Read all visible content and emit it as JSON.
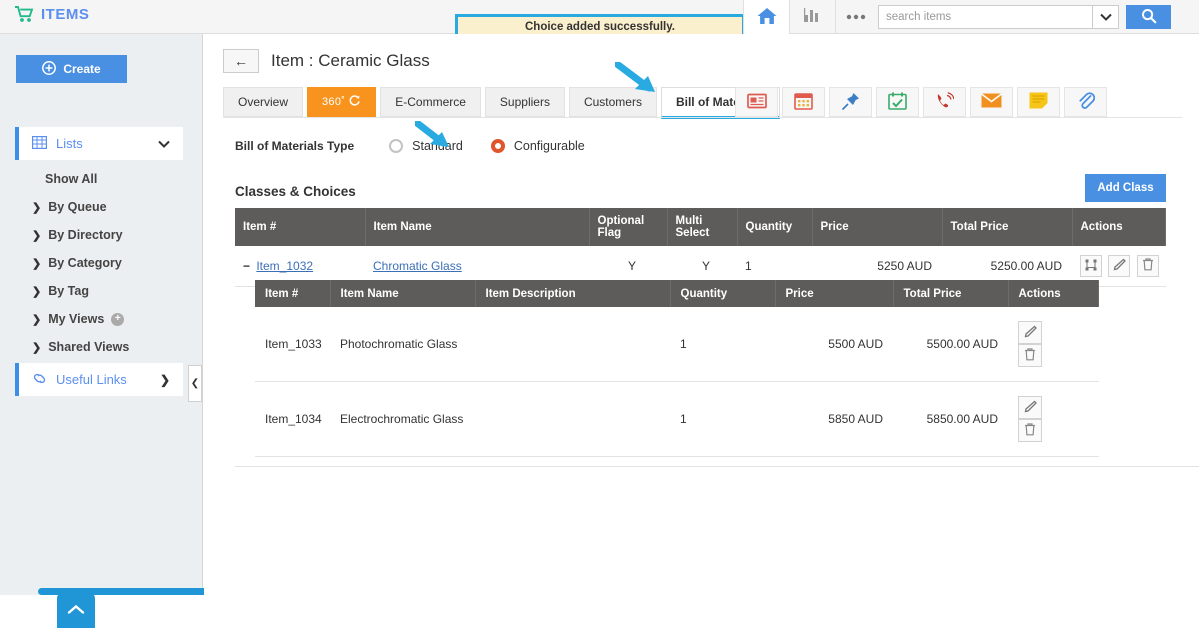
{
  "header": {
    "brand": "ITEMS",
    "brand_icon": "shopping-cart-icon",
    "notification": "Choice added successfully.",
    "home_icon": "home-icon",
    "chart_icon": "bar-chart-icon",
    "more_icon": "ellipsis-icon",
    "search": {
      "value": "",
      "placeholder": "search items"
    },
    "search_caret_icon": "chevron-down-icon",
    "search_button_icon": "search-icon",
    "accent_blue": "#4a90e2",
    "notif_border": "#29abe2",
    "notif_bg": "#fbf0cd"
  },
  "sidebar": {
    "create_label": "Create",
    "create_icon": "plus-circle-icon",
    "lists": {
      "label": "Lists",
      "icon": "grid-icon",
      "chevron": "chevron-down-icon"
    },
    "items": [
      {
        "label": "Show All",
        "has_arrow": false
      },
      {
        "label": "By Queue",
        "has_arrow": true
      },
      {
        "label": "By Directory",
        "has_arrow": true
      },
      {
        "label": "By Category",
        "has_arrow": true
      },
      {
        "label": "By Tag",
        "has_arrow": true
      },
      {
        "label": "My Views",
        "has_arrow": true,
        "has_plus": true
      },
      {
        "label": "Shared Views",
        "has_arrow": true
      }
    ],
    "useful_links": {
      "label": "Useful Links",
      "icon": "link-icon",
      "chevron": "chevron-right-icon"
    },
    "collapse_icon": "chevron-left-icon",
    "scroll_top_icon": "chevron-up-icon"
  },
  "main": {
    "back_icon": "arrow-left-icon",
    "page_title": "Item : Ceramic Glass",
    "tabs": [
      {
        "label": "Overview",
        "state": "normal"
      },
      {
        "label": "360˚",
        "state": "orange"
      },
      {
        "label": "E-Commerce",
        "state": "normal"
      },
      {
        "label": "Suppliers",
        "state": "normal"
      },
      {
        "label": "Customers",
        "state": "normal"
      },
      {
        "label": "Bill of Materials",
        "state": "active"
      }
    ],
    "icon_tabs": [
      {
        "name": "news-card-icon",
        "color": "#e05b4f"
      },
      {
        "name": "calendar-icon",
        "color": "#e05b4f"
      },
      {
        "name": "pin-icon",
        "color": "#3b7fc4"
      },
      {
        "name": "calendar-check-icon",
        "color": "#3bab6b"
      },
      {
        "name": "phone-call-icon",
        "color": "#c0392b"
      },
      {
        "name": "envelope-icon",
        "color": "#f0901e"
      },
      {
        "name": "note-icon",
        "color": "#f5c518"
      },
      {
        "name": "paperclip-icon",
        "color": "#4a90e2"
      }
    ],
    "bom_type": {
      "label": "Bill of Materials Type",
      "options": [
        {
          "label": "Standard",
          "selected": false
        },
        {
          "label": "Configurable",
          "selected": true
        }
      ],
      "selected_color": "#e0552b"
    },
    "section_title": "Classes & Choices",
    "add_class_label": "Add Class",
    "outer_table": {
      "columns": [
        "Item #",
        "Item Name",
        "Optional Flag",
        "Multi Select",
        "Quantity",
        "Price",
        "Total Price",
        "Actions"
      ],
      "rows": [
        {
          "expander": "−",
          "item_no": "Item_1032",
          "item_name": "Chromatic Glass",
          "optional_flag": "Y",
          "multi_select": "Y",
          "quantity": "1",
          "price": "5250 AUD",
          "total_price": "5250.00 AUD",
          "actions": [
            "hierarchy-icon",
            "edit-icon",
            "delete-icon"
          ]
        }
      ]
    },
    "inner_table": {
      "columns": [
        "Item #",
        "Item Name",
        "Item Description",
        "Quantity",
        "Price",
        "Total Price",
        "Actions"
      ],
      "rows": [
        {
          "item_no": "Item_1033",
          "item_name": "Photochromatic Glass",
          "item_description": "",
          "quantity": "1",
          "price": "5500 AUD",
          "total_price": "5500.00 AUD",
          "actions": [
            "edit-icon",
            "delete-icon"
          ]
        },
        {
          "item_no": "Item_1034",
          "item_name": "Electrochromatic Glass",
          "item_description": "",
          "quantity": "1",
          "price": "5850 AUD",
          "total_price": "5850.00 AUD",
          "actions": [
            "edit-icon",
            "delete-icon"
          ]
        }
      ]
    }
  },
  "annotations": {
    "arrow_color": "#29abe2",
    "arrows": [
      {
        "name": "arrow-to-bill-of-materials-tab"
      },
      {
        "name": "arrow-to-configurable-radio"
      }
    ]
  }
}
